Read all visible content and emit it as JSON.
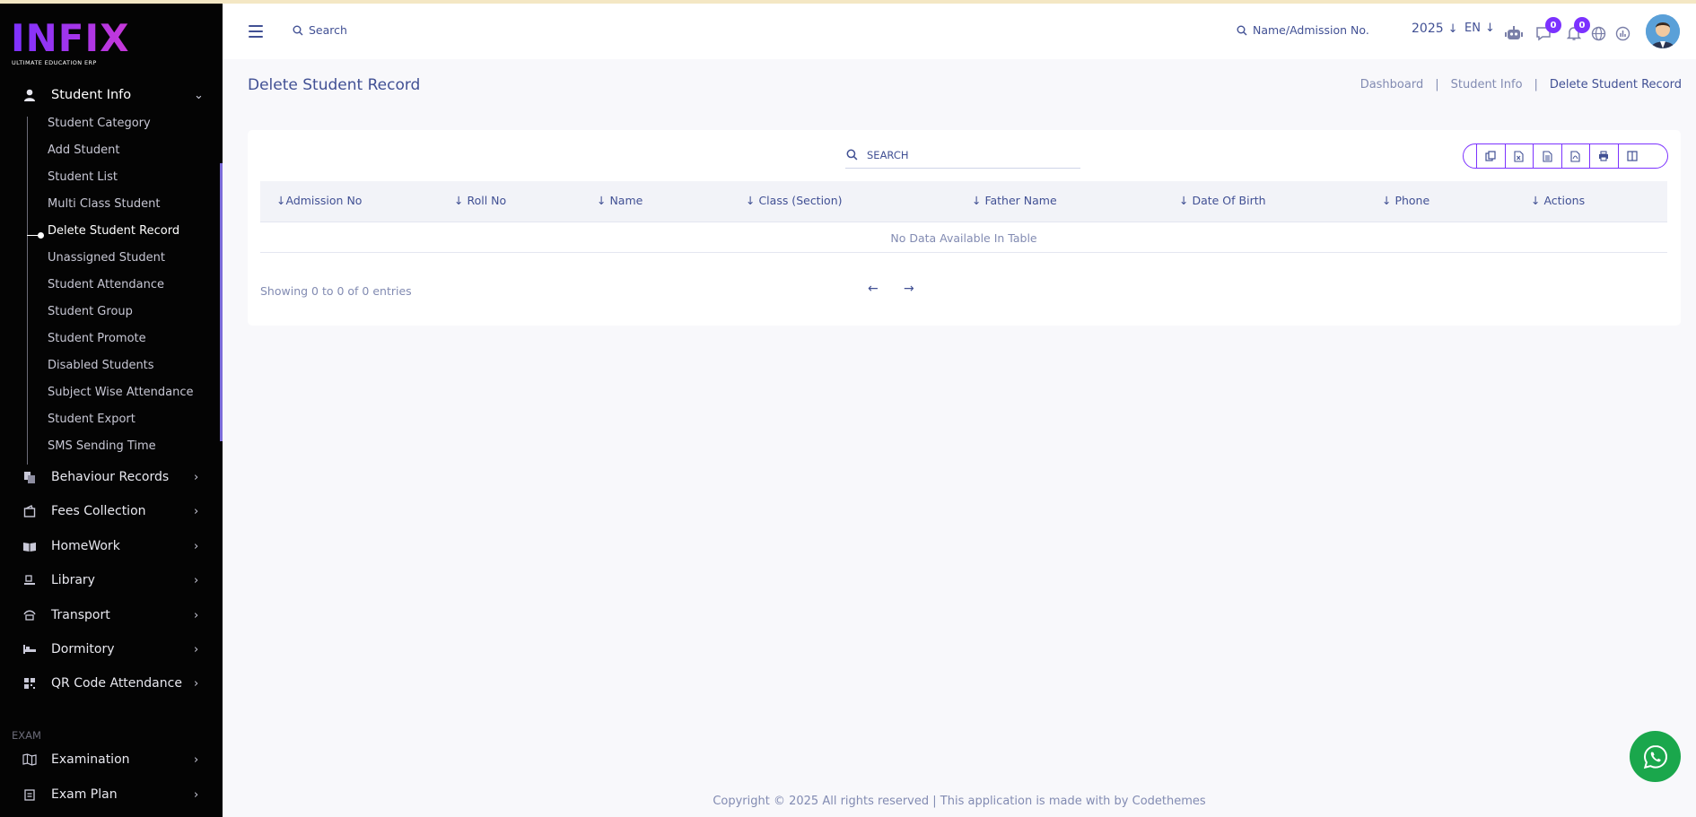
{
  "brand": {
    "logo_text": "INFIX",
    "logo_sub": "ULTIMATE EDUCATION ERP"
  },
  "sidebar": {
    "student_info": {
      "label": "Student Info",
      "icon": "user-icon"
    },
    "sub_items": [
      "Student Category",
      "Add Student",
      "Student List",
      "Multi Class Student",
      "Delete Student Record",
      "Unassigned Student",
      "Student Attendance",
      "Student Group",
      "Student Promote",
      "Disabled Students",
      "Subject Wise Attendance",
      "Student Export",
      "SMS Sending Time"
    ],
    "active_item": "Delete Student Record",
    "menus": [
      {
        "label": "Behaviour Records",
        "icon": "files-icon"
      },
      {
        "label": "Fees Collection",
        "icon": "wallet-icon"
      },
      {
        "label": "HomeWork",
        "icon": "book-icon"
      },
      {
        "label": "Library",
        "icon": "library-icon"
      },
      {
        "label": "Transport",
        "icon": "bus-icon"
      },
      {
        "label": "Dormitory",
        "icon": "bed-icon"
      },
      {
        "label": "QR Code Attendance",
        "icon": "qr-icon"
      }
    ],
    "section_exam": "EXAM",
    "exam_menus": [
      {
        "label": "Examination",
        "icon": "map-icon"
      },
      {
        "label": "Exam Plan",
        "icon": "clipboard-icon"
      }
    ]
  },
  "header": {
    "search_label": "Search",
    "name_search_label": "Name/Admission No.",
    "year": "2025",
    "language": "EN",
    "messages_count": "0",
    "notifications_count": "0"
  },
  "page": {
    "title": "Delete Student Record",
    "breadcrumb": [
      "Dashboard",
      "Student Info",
      "Delete Student Record"
    ]
  },
  "table": {
    "search_placeholder": "SEARCH",
    "columns": [
      "Admission No",
      "Roll No",
      "Name",
      "Class (Section)",
      "Father Name",
      "Date Of Birth",
      "Phone",
      "Actions"
    ],
    "empty_message": "No Data Available In Table",
    "info": "Showing 0 to 0 of 0 entries",
    "prev": "←",
    "next": "→"
  },
  "footer": {
    "text": "Copyright © 2025 All rights reserved | This application is made with by Codethemes"
  },
  "colors": {
    "accent": "#7c32ff",
    "text": "#415094",
    "sidebar_bg": "#040404",
    "whatsapp": "#1aa74c"
  }
}
